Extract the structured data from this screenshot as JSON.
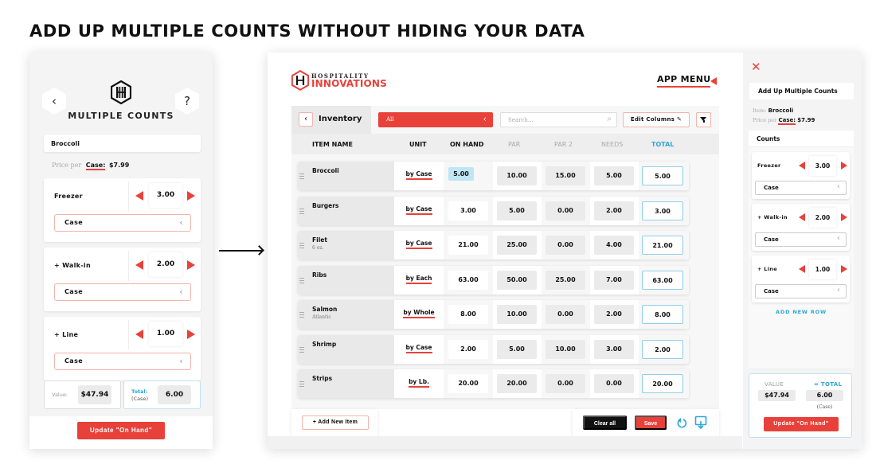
{
  "headline": "ADD UP MULTIPLE COUNTS WITHOUT HIDING YOUR DATA",
  "colors": {
    "accent": "#e8413a",
    "info": "#2ba8de",
    "highlight": "#bfe6f4"
  },
  "mobile": {
    "back_icon": "chevron-left-icon",
    "help_label": "?",
    "title": "MULTIPLE COUNTS",
    "item": "Broccoli",
    "price_label": "Price per",
    "price_unit": "Case:",
    "price_value": "$7.99",
    "counts": [
      {
        "name": "Freezer",
        "qty": "3.00",
        "unit": "Case"
      },
      {
        "name": "+ Walk-in",
        "qty": "2.00",
        "unit": "Case"
      },
      {
        "name": "+ Line",
        "qty": "1.00",
        "unit": "Case"
      }
    ],
    "value_label": "Value:",
    "value": "$47.94",
    "total_label": "Total:",
    "total_unit": "(Case)",
    "total": "6.00",
    "update_button": "Update \"On Hand\""
  },
  "tablet": {
    "brand_top": "HOSPITALITY",
    "brand_bottom": "INNOVATIONS",
    "app_menu": "APP MENU",
    "section_title": "Inventory",
    "category": "All",
    "search_placeholder": "Search...",
    "edit_columns": "Edit Columns",
    "columns": [
      "ITEM NAME",
      "UNIT",
      "ON HAND",
      "PAR",
      "PAR 2",
      "NEEDS",
      "TOTAL"
    ],
    "rows": [
      {
        "name": "Broccoli",
        "sub": "",
        "unit": "by Case",
        "on_hand": "5.00",
        "par": "10.00",
        "par2": "15.00",
        "needs": "5.00",
        "total": "5.00"
      },
      {
        "name": "Burgers",
        "sub": "",
        "unit": "by Case",
        "on_hand": "3.00",
        "par": "5.00",
        "par2": "0.00",
        "needs": "2.00",
        "total": "3.00"
      },
      {
        "name": "Filet",
        "sub": "6 oz.",
        "unit": "by Case",
        "on_hand": "21.00",
        "par": "25.00",
        "par2": "0.00",
        "needs": "4.00",
        "total": "21.00"
      },
      {
        "name": "Ribs",
        "sub": "",
        "unit": "by Each",
        "on_hand": "63.00",
        "par": "50.00",
        "par2": "25.00",
        "needs": "7.00",
        "total": "63.00"
      },
      {
        "name": "Salmon",
        "sub": "Atlantic",
        "unit": "by Whole",
        "on_hand": "8.00",
        "par": "10.00",
        "par2": "0.00",
        "needs": "2.00",
        "total": "8.00"
      },
      {
        "name": "Shrimp",
        "sub": "",
        "unit": "by Case",
        "on_hand": "2.00",
        "par": "5.00",
        "par2": "10.00",
        "needs": "3.00",
        "total": "2.00"
      },
      {
        "name": "Strips",
        "sub": "",
        "unit": "by Lb.",
        "on_hand": "20.00",
        "par": "20.00",
        "par2": "0.00",
        "needs": "0.00",
        "total": "20.00"
      }
    ],
    "add_item": "+ Add New Item",
    "clear_all": "Clear all",
    "save": "Save"
  },
  "drawer": {
    "title": "Add Up Multiple Counts",
    "item_label": "Item:",
    "item": "Broccoli",
    "price_label": "Price per",
    "price_unit": "Case:",
    "price_value": "$7.99",
    "counts_header": "Counts",
    "counts": [
      {
        "name": "Freezer",
        "qty": "3.00",
        "unit": "Case"
      },
      {
        "name": "+ Walk-in",
        "qty": "2.00",
        "unit": "Case"
      },
      {
        "name": "+ Line",
        "qty": "1.00",
        "unit": "Case"
      }
    ],
    "add_row": "ADD NEW ROW",
    "value_label": "VALUE",
    "value": "$47.94",
    "total_label": "= TOTAL",
    "total": "6.00",
    "total_unit": "(Case)",
    "update_button": "Update \"On Hand\""
  }
}
